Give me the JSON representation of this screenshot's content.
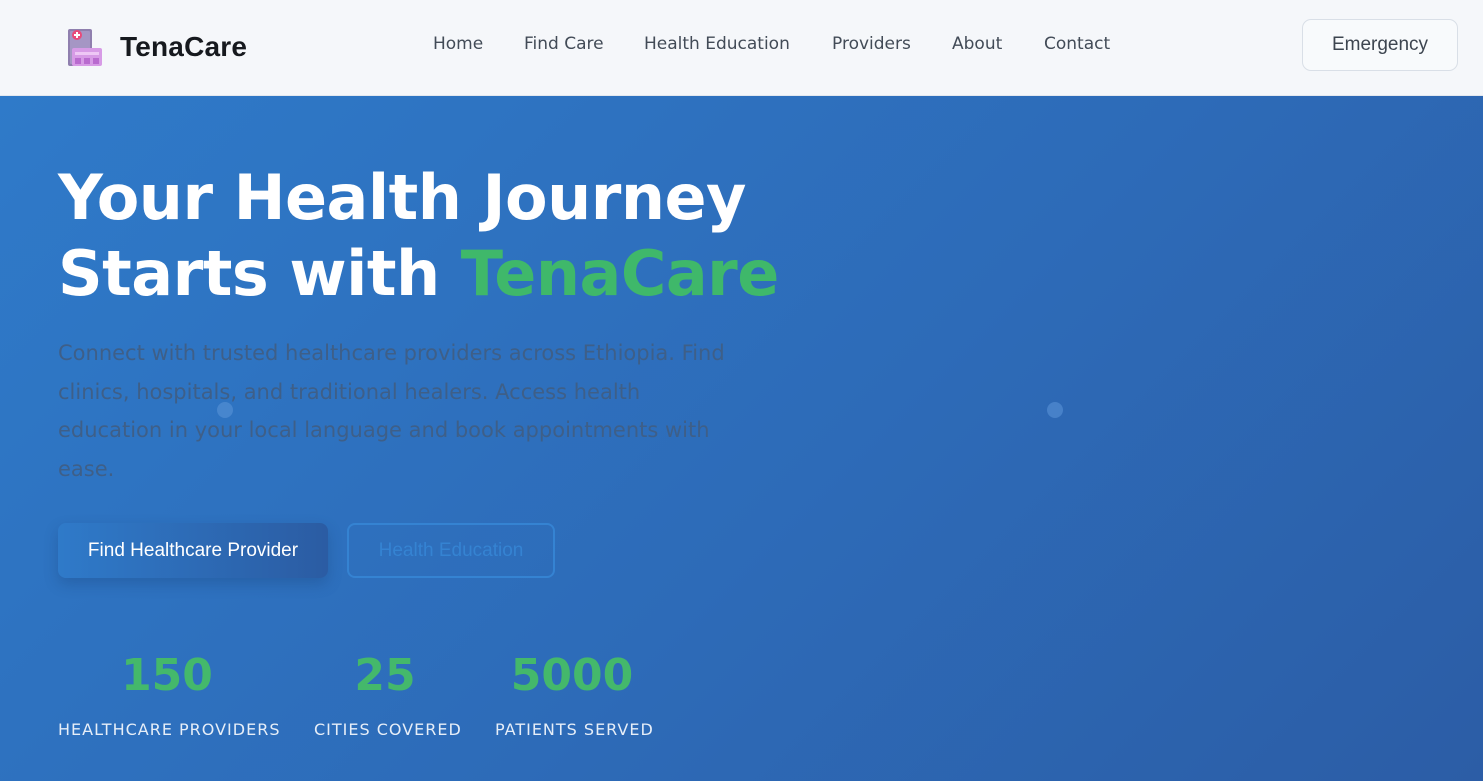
{
  "nav": {
    "brand": "TenaCare",
    "links": [
      "Home",
      "Find Care",
      "Health Education",
      "Providers",
      "About",
      "Contact"
    ],
    "emergency_label": "Emergency"
  },
  "hero": {
    "title_line1": "Your Health Journey",
    "title_line2_prefix": "Starts with ",
    "title_accent": "TenaCare",
    "description": "Connect with trusted healthcare providers across Ethiopia. Find clinics, hospitals, and traditional healers. Access health education in your local language and book appointments with ease.",
    "primary_button": "Find Healthcare Provider",
    "secondary_button": "Health Education"
  },
  "stats": [
    {
      "value": "150",
      "label": "HEALTHCARE PROVIDERS"
    },
    {
      "value": "25",
      "label": "CITIES COVERED"
    },
    {
      "value": "5000",
      "label": "PATIENTS SERVED"
    }
  ],
  "colors": {
    "accent_green": "#3fb86a",
    "hero_blue": "#2e6fbf",
    "nav_bg": "#f5f7fa"
  },
  "icons": {
    "brand_logo": "hospital-building-icon"
  }
}
